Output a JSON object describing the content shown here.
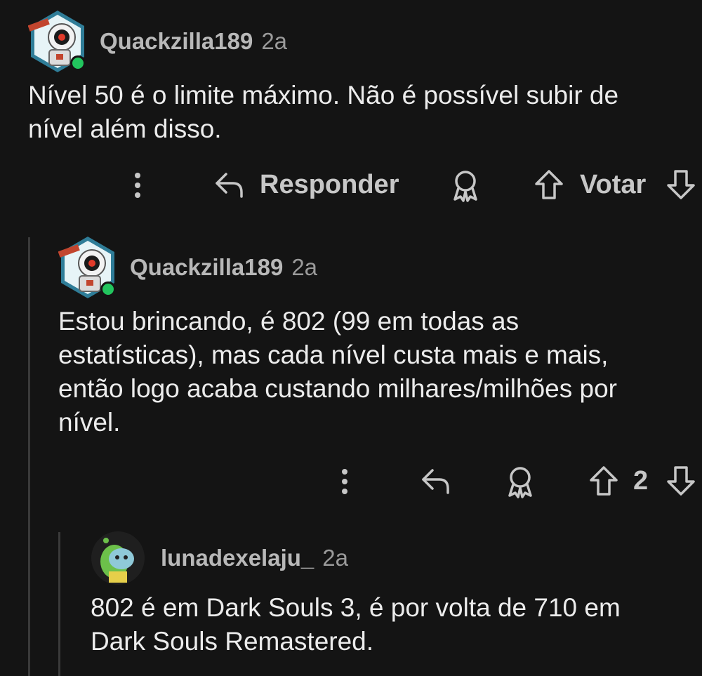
{
  "comments": [
    {
      "username": "Quackzilla189",
      "age": "2a",
      "text": "Nível 50 é o limite máximo. Não é possível subir de\nnível além disso.",
      "actions": {
        "reply_label": "Responder",
        "vote_label": "Votar"
      }
    },
    {
      "username": "Quackzilla189",
      "age": "2a",
      "text": "Estou brincando, é 802 (99 em todas as\nestatísticas), mas cada nível custa mais e mais,\nentão logo acaba custando milhares/milhões por\nnível.",
      "actions": {
        "vote_count": "2"
      }
    },
    {
      "username": "lunadexelaju_",
      "age": "2a",
      "text": "802 é em Dark Souls 3, é por volta de 710 em\nDark Souls Remastered."
    }
  ],
  "icons": {
    "more": "more-vertical-icon",
    "reply": "reply-arrow-icon",
    "award": "award-icon",
    "upvote": "upvote-arrow-icon",
    "downvote": "downvote-arrow-icon"
  },
  "colors": {
    "background": "#141414",
    "online": "#22c55e",
    "muted": "#b8b8b8"
  }
}
